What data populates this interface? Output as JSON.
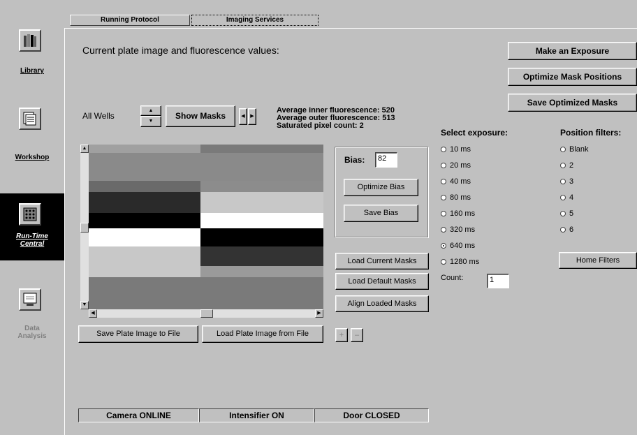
{
  "nav": {
    "items": [
      {
        "label": "Library"
      },
      {
        "label": "Workshop"
      },
      {
        "label": "Run-Time Central"
      },
      {
        "label": "Data Analysis"
      }
    ]
  },
  "tabs": [
    {
      "label": "Running Protocol"
    },
    {
      "label": "Imaging Services"
    }
  ],
  "main": {
    "heading": "Current plate image and fluorescence values:",
    "well_selector": "All Wells",
    "show_masks_label": "Show Masks",
    "info": {
      "inner": "Average inner fluorescence: 520",
      "outer": "Average outer fluorescence: 513",
      "saturated": "Saturated pixel count: 2"
    },
    "bias": {
      "label": "Bias:",
      "value": "82",
      "optimize_label": "Optimize Bias",
      "save_label": "Save Bias"
    },
    "mask_buttons": {
      "load_current": "Load Current Masks",
      "load_default": "Load Default Masks",
      "align_loaded": "Align Loaded Masks"
    },
    "image_buttons": {
      "save": "Save Plate Image to File",
      "load": "Load Plate Image from File",
      "zoom_in": "+",
      "zoom_out": "–"
    }
  },
  "actions": {
    "make_exposure": "Make an Exposure",
    "optimize_mask": "Optimize Mask Positions",
    "save_masks": "Save Optimized Masks"
  },
  "exposure": {
    "label": "Select exposure:",
    "options": [
      "10 ms",
      "20 ms",
      "40 ms",
      "80 ms",
      "160 ms",
      "320 ms",
      "640 ms",
      "1280 ms"
    ],
    "selected": "640 ms",
    "count_label": "Count:",
    "count_value": "1"
  },
  "filters": {
    "label": "Position filters:",
    "options": [
      "Blank",
      "2",
      "3",
      "4",
      "5",
      "6"
    ],
    "home_label": "Home Filters"
  },
  "status": {
    "camera": "Camera ONLINE",
    "intensifier": "Intensifier ON",
    "door": "Door CLOSED"
  }
}
